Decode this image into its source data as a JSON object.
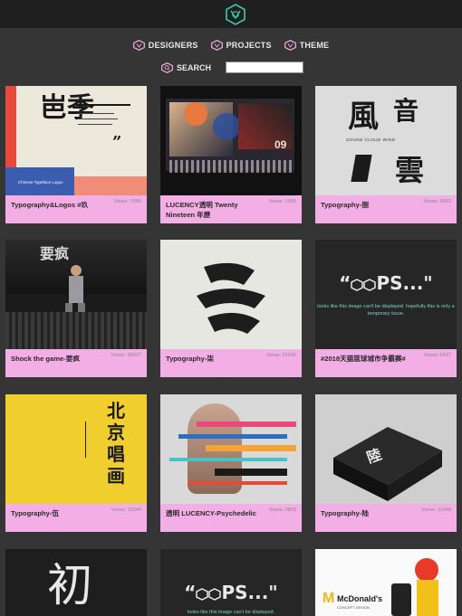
{
  "header": {
    "logo": "hexagon-logo"
  },
  "nav": {
    "items": [
      {
        "label": "DESIGNERS",
        "icon": "hexagon-icon"
      },
      {
        "label": "PROJECTS",
        "icon": "hexagon-icon"
      },
      {
        "label": "THEME",
        "icon": "hexagon-icon"
      }
    ]
  },
  "search": {
    "label": "SEARCH",
    "icon": "hexagon-search-icon",
    "value": ""
  },
  "colors": {
    "background": "#353535",
    "topbar": "#1f1f1f",
    "card": "#f3aee5",
    "accent": "#f3aee5"
  },
  "cards": [
    {
      "title": "Typography&Logos #玖",
      "views": "Views: 7668",
      "thumb_text": "Chinese Typeface Logos"
    },
    {
      "title": "LUCENCY透明 Twenty Nineteen 年歷",
      "views": "Views: 1980",
      "thumb_text": "09"
    },
    {
      "title": "Typography-捌",
      "views": "Views: 9033",
      "thumb_text": "SOUND CLOUD WIND"
    },
    {
      "title": "Shock the game-要疯",
      "views": "Views: 38427",
      "thumb_text": "要疯"
    },
    {
      "title": "Typography-柒",
      "views": "Views: 21930",
      "thumb_text": ""
    },
    {
      "title": "#2018天猫篮球城市争霸赛#",
      "views": "Views: 6437",
      "thumb_text": "PS...\"",
      "thumb_sub": "looks like this image can't be displayed. hopefully this is only a temporary issue."
    },
    {
      "title": "Typography-伍",
      "views": "Views: 16344",
      "thumb_text": "北京 唱 画"
    },
    {
      "title": "透明 LUCENCY-Psychedelic",
      "views": "Views: 2823",
      "thumb_text": ""
    },
    {
      "title": "Typography-陆",
      "views": "Views: 11348",
      "thumb_text": ""
    },
    {
      "title": "",
      "views": "",
      "thumb_text": "初"
    },
    {
      "title": "",
      "views": "",
      "thumb_text": "PS...\"",
      "thumb_sub": "looks like this image can't be displayed."
    },
    {
      "title": "",
      "views": "",
      "thumb_text": "McDonald's",
      "thumb_sub": "CONCEPT DESIGN"
    }
  ]
}
